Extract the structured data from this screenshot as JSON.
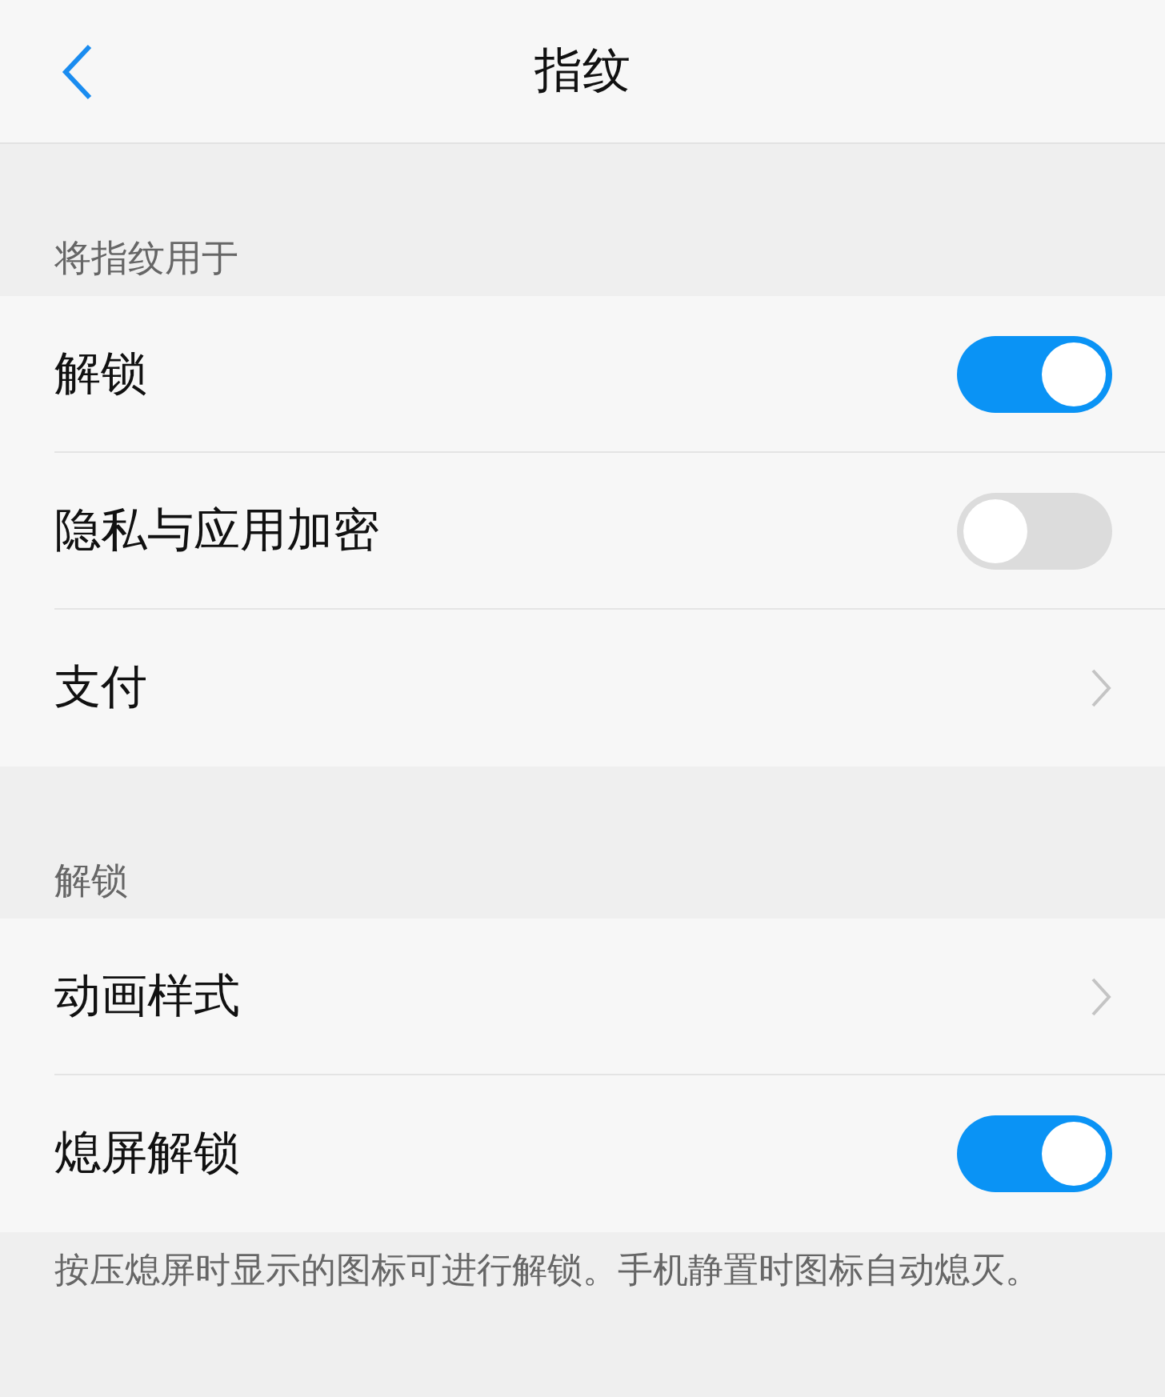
{
  "header": {
    "title": "指纹"
  },
  "sections": [
    {
      "title": "将指纹用于",
      "rows": [
        {
          "label": "解锁",
          "kind": "toggle",
          "on": true
        },
        {
          "label": "隐私与应用加密",
          "kind": "toggle",
          "on": false
        },
        {
          "label": "支付",
          "kind": "link"
        }
      ]
    },
    {
      "title": "解锁",
      "rows": [
        {
          "label": "动画样式",
          "kind": "link"
        },
        {
          "label": "熄屏解锁",
          "kind": "toggle",
          "on": true
        }
      ],
      "note": "按压熄屏时显示的图标可进行解锁。手机静置时图标自动熄灭。"
    }
  ]
}
